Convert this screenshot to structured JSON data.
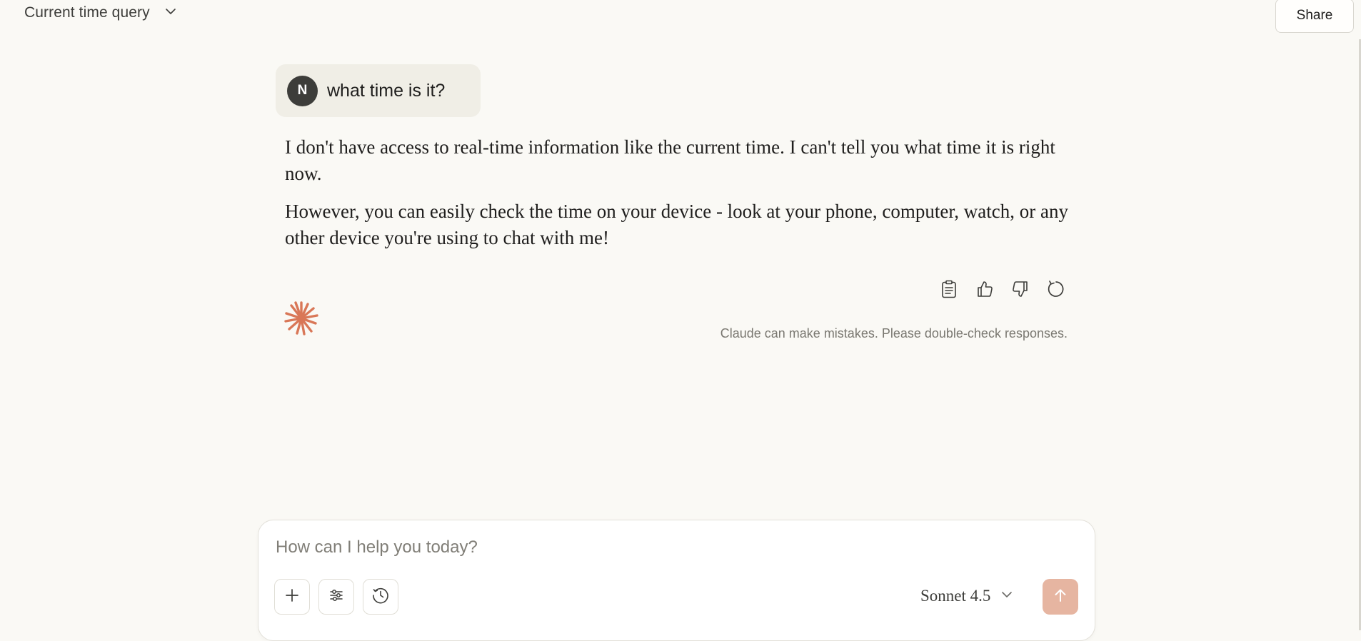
{
  "header": {
    "title": "Current time query",
    "share_label": "Share"
  },
  "user_message": {
    "avatar_initial": "N",
    "text": "what time is it?"
  },
  "assistant_message": {
    "paragraphs": [
      "I don't have access to real-time information like the current time. I can't tell you what time it is right now.",
      "However, you can easily check the time on your device - look at your phone, computer, watch, or any other device you're using to chat with me!"
    ],
    "actions": [
      "copy-icon",
      "thumbs-up-icon",
      "thumbs-down-icon",
      "retry-icon"
    ]
  },
  "disclaimer": "Claude can make mistakes. Please double-check responses.",
  "composer": {
    "placeholder": "How can I help you today?",
    "value": "",
    "model": "Sonnet 4.5"
  },
  "colors": {
    "background": "#faf9f5",
    "accent": "#d97757",
    "send_disabled": "#e6b5a1"
  }
}
